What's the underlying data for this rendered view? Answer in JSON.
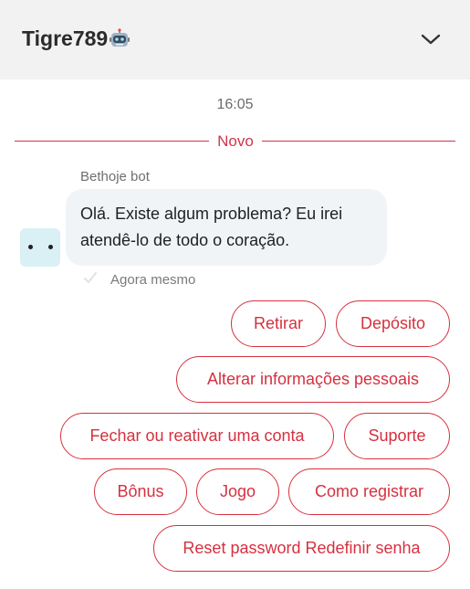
{
  "header": {
    "title": "Tigre789",
    "title_icon": "robot-icon",
    "collapse_icon": "chevron-down-icon"
  },
  "conversation": {
    "timestamp": "16:05",
    "divider_label": "Novo",
    "messages": [
      {
        "sender": "Bethoje bot",
        "avatar_icon": "bot-face-icon",
        "lines": [
          "Olá. Existe algum problema? Eu irei",
          "atendê-lo de todo o coração."
        ],
        "time": "Agora mesmo"
      }
    ]
  },
  "quick_replies": [
    "Retirar",
    "Depósito",
    "Alterar informações pessoais",
    "Fechar ou reativar uma conta",
    "Suporte",
    "Bônus",
    "Jogo",
    "Como registrar",
    "Reset password Redefinir senha"
  ],
  "colors": {
    "accent": "#d6303f",
    "header_bg": "#f2f2f2",
    "bubble_bg": "#f1f4f7",
    "avatar_bg": "#d9f0f5"
  }
}
